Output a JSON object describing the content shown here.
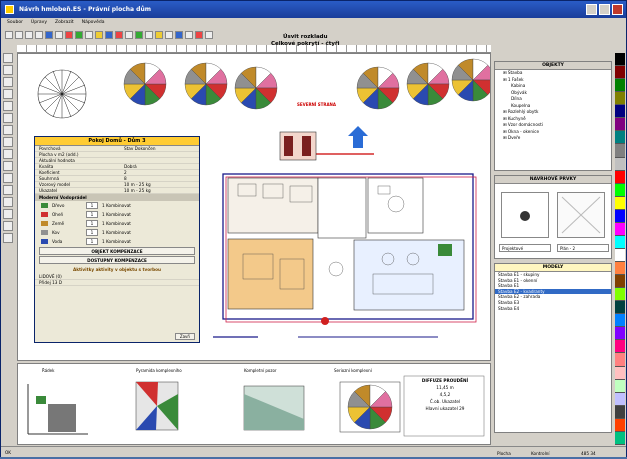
{
  "window": {
    "title": "Návrh hmlobeň.ES - Právní plocha dům"
  },
  "menu": [
    "Soubor",
    "Úpravy",
    "Zobrazit",
    "Nápověda"
  ],
  "canvas": {
    "caption_line1": "Úsvit rozkladu",
    "caption_line2": "Celkové pokrytí - čtyři ",
    "north_label": "SEVERNÍ STRANA"
  },
  "props": {
    "title": "Pokoj Domů - Dům 3",
    "rows": [
      {
        "k": "Povrchová",
        "v": "Stav Dokončen"
      },
      {
        "k": "Plocha v m2 (odd.)",
        "v": ""
      },
      {
        "k": "Aktuální hodnota",
        "v": ""
      },
      {
        "k": "Kvalita",
        "v": "Dobrá"
      },
      {
        "k": "Koeficient",
        "v": "2"
      },
      {
        "k": "Souhrnná",
        "v": "8"
      },
      {
        "k": "Vzorový model",
        "v": "10 m - 25 kg"
      },
      {
        "k": "Ukazatel",
        "v": "10 m - 25 kg"
      }
    ],
    "section": "Moderní Vodoprádel",
    "sources": [
      {
        "name": "Dřevo",
        "val": "1",
        "rest": "1 Kombinovat",
        "color": "#3a8a3a"
      },
      {
        "name": "Oheň",
        "val": "1",
        "rest": "1 Kombinovat",
        "color": "#d03030"
      },
      {
        "name": "Země",
        "val": "1",
        "rest": "1 Kombinovat",
        "color": "#c08a2a"
      },
      {
        "name": "Kov",
        "val": "1",
        "rest": "1 Kombinovat",
        "color": "#909090"
      },
      {
        "name": "Voda",
        "val": "1",
        "rest": "1 Kombinovat",
        "color": "#2a4ab0"
      }
    ],
    "btn1": "OBJEKT KOMPENZACE",
    "btn2": "DOSTUPNÝ KOMPENZACE",
    "note": "Aktivitky aktivity v objektu s tvorbou",
    "extra1": "LIDOVÉ (0)",
    "extra2": "Přidej 13 D",
    "ok": "Zavři"
  },
  "bottom": {
    "labels": [
      "Řádek",
      "Pyramida komplexního",
      "Kompletní pozor",
      "Seriozní komplexní"
    ],
    "diffuse_title": "DIFFUZE PROUDĚNÍ",
    "diffuse_v1": "11,45 m",
    "diffuse_v2": "4,5,2",
    "diffuse_v3": "Č.ob.    Ukazatel",
    "diffuse_v4": "Hlavní ukazatel 29"
  },
  "right": {
    "tree_title": "OBJEKTY",
    "tree": [
      "Stavba",
      "1 Fašek",
      "Kabina",
      "Obývák",
      "Dílna",
      "Koupelna",
      "Rozlehlý obytk",
      "Kuchyně",
      "Vzor domácnosti",
      "Okna - okenice",
      "Dveře"
    ],
    "preview_title": "NAVRHOVÉ PRVKY",
    "dropdown1": "Projektové",
    "dropdown2": "Plán - 2",
    "list_title": "MODELY",
    "list": [
      "Stavba E1 - skupiny",
      "Stavba E1 - okenní",
      "Stavba E1",
      "Stavba E2 - kvadranty",
      "Stavba E2 - zahrada",
      "Stavba E3",
      "Stavba E4"
    ],
    "selected_index": 3
  },
  "status": {
    "left": "OK",
    "mid": "Plocha",
    "right1": "Kontrolní",
    "right2": "485  34"
  },
  "palette": [
    "#000000",
    "#800000",
    "#008000",
    "#808000",
    "#000080",
    "#800080",
    "#008080",
    "#808080",
    "#c0c0c0",
    "#ff0000",
    "#00ff00",
    "#ffff00",
    "#0000ff",
    "#ff00ff",
    "#00ffff",
    "#ffffff",
    "#ff8040",
    "#804000",
    "#80ff00",
    "#004040",
    "#0080ff",
    "#8000ff",
    "#ff0080",
    "#ff8080",
    "#ffc0c0",
    "#c0ffc0",
    "#c0c0ff",
    "#404040",
    "#ff4000",
    "#00c080"
  ]
}
